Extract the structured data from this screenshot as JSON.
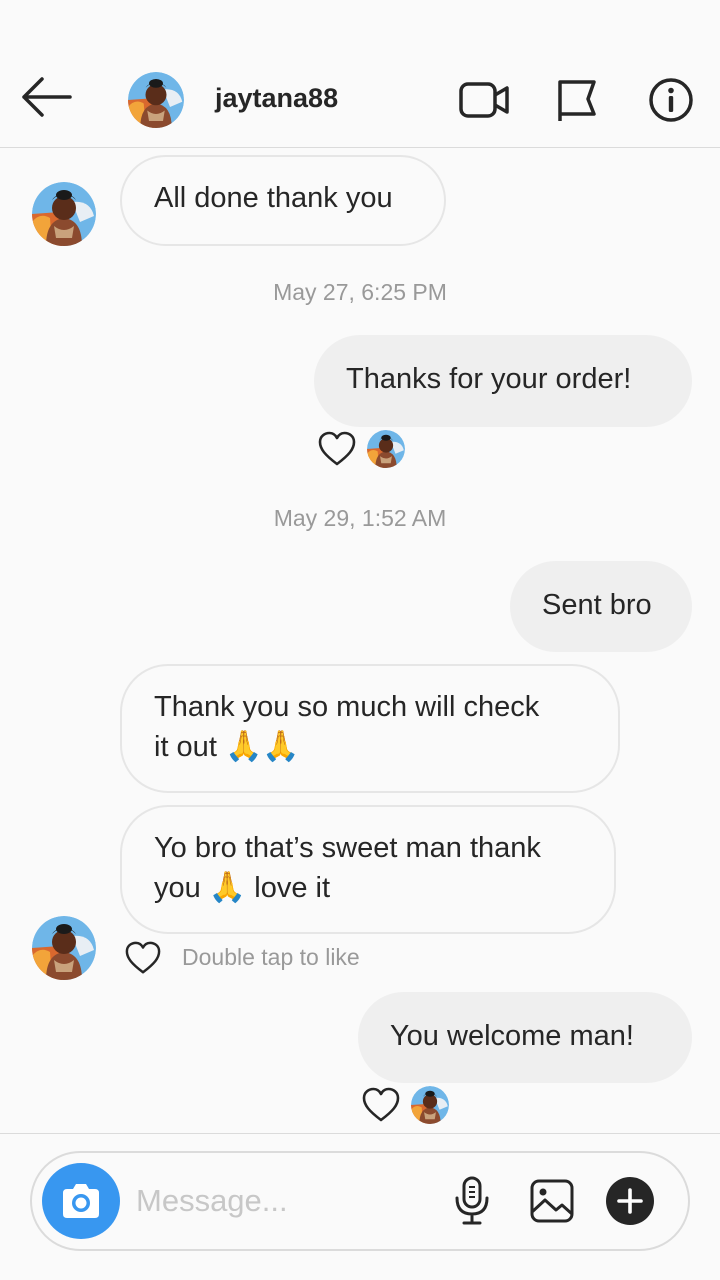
{
  "header": {
    "username": "jaytana88",
    "icons": [
      "back-arrow-icon",
      "video-camera-icon",
      "flag-icon",
      "info-icon"
    ]
  },
  "messages": [
    {
      "from": "them",
      "text": "All done thank you"
    },
    {
      "type": "timestamp",
      "text": "May 27, 6:25 PM"
    },
    {
      "from": "me",
      "text": "Thanks for your order!",
      "liked": true
    },
    {
      "type": "timestamp",
      "text": "May 29, 1:52 AM"
    },
    {
      "from": "me",
      "text": "Sent bro"
    },
    {
      "from": "them",
      "line1": "Thank you so much will check",
      "line2": "it out",
      "emoji": "🙏🙏"
    },
    {
      "from": "them",
      "line1": "Yo bro that’s sweet man thank",
      "line2a": "you",
      "emoji": "🙏",
      "line2b": "love it"
    },
    {
      "from": "me",
      "text": "You welcome man!",
      "liked": true
    }
  ],
  "like_hint": "Double tap to like",
  "composer": {
    "placeholder": "Message...",
    "icons": [
      "camera-icon",
      "microphone-icon",
      "gallery-icon",
      "plus-icon"
    ]
  },
  "colors": {
    "accent": "#3897f0",
    "bubble_out": "#efefef",
    "bubble_in_border": "#e6e6e6",
    "text": "#262626",
    "muted": "#999999"
  }
}
